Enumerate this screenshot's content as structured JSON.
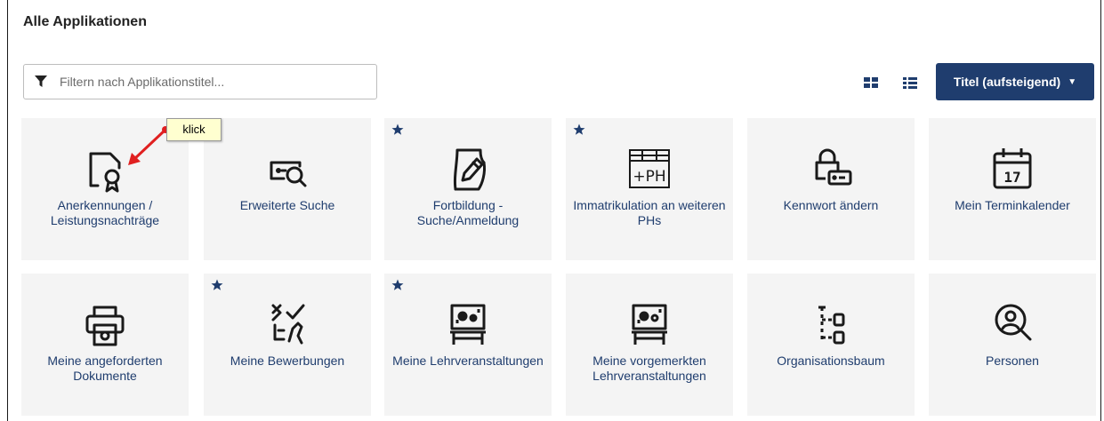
{
  "page": {
    "title": "Alle Applikationen"
  },
  "filter": {
    "placeholder": "Filtern nach Applikationstitel..."
  },
  "view": {
    "grid_icon": "grid-view-icon",
    "list_icon": "list-view-icon"
  },
  "sort": {
    "label": "Titel (aufsteigend)"
  },
  "annotation": {
    "text": "klick"
  },
  "colors": {
    "accent": "#1f3d6e",
    "tile_bg": "#f4f4f4",
    "note_bg": "#ffffd0",
    "arrow": "#e02020"
  },
  "apps": [
    {
      "label": "Anerkennungen / Leistungsnachträge",
      "favorite": false,
      "icon": "certificate-icon"
    },
    {
      "label": "Erweiterte Suche",
      "favorite": false,
      "icon": "advanced-search-icon"
    },
    {
      "label": "Fortbildung - Suche/Anmeldung",
      "favorite": true,
      "icon": "pen-document-icon"
    },
    {
      "label": "Immatrikulation an weiteren PHs",
      "favorite": true,
      "icon": "plus-ph-icon"
    },
    {
      "label": "Kennwort ändern",
      "favorite": false,
      "icon": "lock-password-icon"
    },
    {
      "label": "Mein Terminkalender",
      "favorite": false,
      "icon": "calendar-icon"
    },
    {
      "label": "Meine angeforderten Dokumente",
      "favorite": false,
      "icon": "printer-icon"
    },
    {
      "label": "Meine Bewerbungen",
      "favorite": true,
      "icon": "application-icon"
    },
    {
      "label": "Meine Lehrveranstaltungen",
      "favorite": true,
      "icon": "lecture-icon"
    },
    {
      "label": "Meine vorgemerkten Lehrveranstaltungen",
      "favorite": false,
      "icon": "bookmarked-lecture-icon"
    },
    {
      "label": "Organisationsbaum",
      "favorite": false,
      "icon": "org-tree-icon"
    },
    {
      "label": "Personen",
      "favorite": false,
      "icon": "person-search-icon"
    }
  ]
}
